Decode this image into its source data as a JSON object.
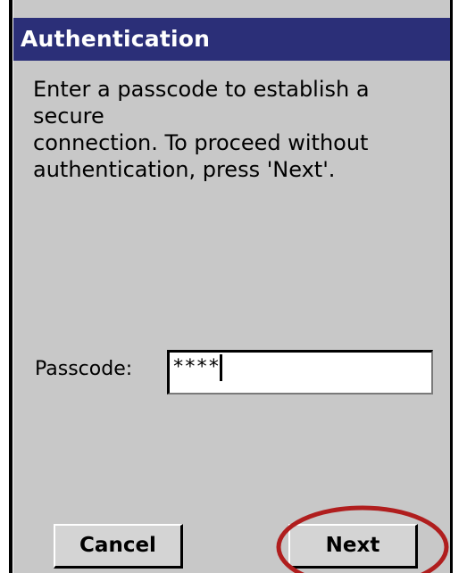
{
  "dialog": {
    "title": "Authentication",
    "instructions": "Enter a passcode to establish a secure\nconnection. To proceed without\nauthentication, press 'Next'.",
    "passcode_label": "Passcode:",
    "passcode_value": "****"
  },
  "buttons": {
    "cancel_label": "Cancel",
    "next_label": "Next"
  },
  "colors": {
    "title_bar": "#2b2f78",
    "dialog_background": "#c8c8c8",
    "highlight_ellipse": "#b01e1e"
  }
}
